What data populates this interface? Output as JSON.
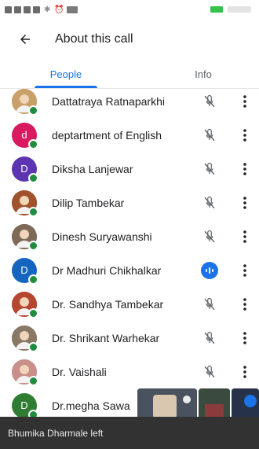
{
  "status_bar": {
    "indicators": [
      "notification-icon",
      "notification-icon",
      "notification-icon",
      "notification-icon",
      "bluetooth-icon",
      "alarm-icon",
      "data-badge-icon"
    ],
    "battery_color": "#34c24a"
  },
  "header": {
    "title": "About this call"
  },
  "tabs": [
    {
      "label": "People",
      "active": true
    },
    {
      "label": "Info",
      "active": false
    }
  ],
  "accent_color": "#1a73e8",
  "participants": [
    {
      "name": "Dattatraya Ratnaparkhi",
      "avatar_type": "photo",
      "avatar_color": "#c9a068",
      "mic": "muted"
    },
    {
      "name": "deptartment of English",
      "avatar_type": "letter",
      "initial": "d",
      "avatar_color": "#d81b60",
      "mic": "muted"
    },
    {
      "name": "Diksha Lanjewar",
      "avatar_type": "letter",
      "initial": "D",
      "avatar_color": "#5e35b1",
      "mic": "muted"
    },
    {
      "name": "Dilip Tambekar",
      "avatar_type": "photo",
      "avatar_color": "#a0522d",
      "mic": "muted"
    },
    {
      "name": "Dinesh Suryawanshi",
      "avatar_type": "photo",
      "avatar_color": "#7d6a58",
      "mic": "muted"
    },
    {
      "name": "Dr Madhuri Chikhalkar",
      "avatar_type": "letter",
      "initial": "D",
      "avatar_color": "#1565c0",
      "mic": "speaking"
    },
    {
      "name": "Dr. Sandhya Tambekar",
      "avatar_type": "photo",
      "avatar_color": "#b5462f",
      "mic": "muted"
    },
    {
      "name": "Dr. Shrikant Warhekar",
      "avatar_type": "photo",
      "avatar_color": "#8a7867",
      "mic": "muted"
    },
    {
      "name": "Dr. Vaishali",
      "avatar_type": "photo",
      "avatar_color": "#c98f8a",
      "mic": "muted"
    },
    {
      "name": "Dr.megha Sawa",
      "avatar_type": "letter",
      "initial": "D",
      "avatar_color": "#2e7d32",
      "mic": "hidden"
    }
  ],
  "snackbar": {
    "text": "Bhumika Dharmale left"
  }
}
